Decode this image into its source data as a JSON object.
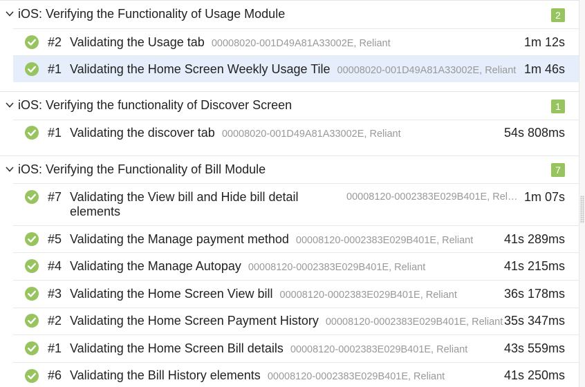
{
  "groups": [
    {
      "title": "iOS: Verifying the Functionality of Usage Module",
      "count": "2",
      "rows": [
        {
          "num": "#2",
          "title": "Validating the Usage tab",
          "meta": "00008020-001D49A81A33002E, Reliant",
          "duration": "1m 12s"
        },
        {
          "num": "#1",
          "title": "Validating the Home Screen Weekly Usage Tile",
          "meta": "00008020-001D49A81A33002E, Reliant",
          "duration": "1m 46s"
        }
      ]
    },
    {
      "title": "iOS: Verifying the functionality of Discover Screen",
      "count": "1",
      "rows": [
        {
          "num": "#1",
          "title": "Validating the discover tab",
          "meta": "00008020-001D49A81A33002E, Reliant",
          "duration": "54s 808ms"
        }
      ]
    },
    {
      "title": "iOS: Verifying the Functionality of Bill Module",
      "count": "7",
      "rows": [
        {
          "num": "#7",
          "title_line1": "Validating the View bill and Hide bill detail",
          "title_line2": "elements",
          "meta": "00008120-0002383E029B401E, Rel…",
          "duration": "1m 07s"
        },
        {
          "num": "#5",
          "title": "Validating the Manage payment method",
          "meta": "00008120-0002383E029B401E, Reliant",
          "duration": "41s 289ms"
        },
        {
          "num": "#4",
          "title": "Validating the Manage Autopay",
          "meta": "00008120-0002383E029B401E, Reliant",
          "duration": "41s 215ms"
        },
        {
          "num": "#3",
          "title": "Validating the Home Screen View bill",
          "meta": "00008120-0002383E029B401E, Reliant",
          "duration": "36s 178ms"
        },
        {
          "num": "#2",
          "title": "Validating the Home Screen Payment History",
          "meta": "00008120-0002383E029B401E, Reliant",
          "duration": "35s 347ms"
        },
        {
          "num": "#1",
          "title": "Validating the Home Screen Bill details",
          "meta": "00008120-0002383E029B401E, Reliant",
          "duration": "43s 559ms"
        },
        {
          "num": "#6",
          "title": "Validating the Bill History elements",
          "meta": "00008120-0002383E029B401E, Reliant",
          "duration": "41s 250ms"
        }
      ]
    }
  ],
  "status_icon": "check-circle-icon",
  "colors": {
    "passed": "#97c45f",
    "badge": "#97c45f",
    "selected_row": "#e5eefa"
  }
}
